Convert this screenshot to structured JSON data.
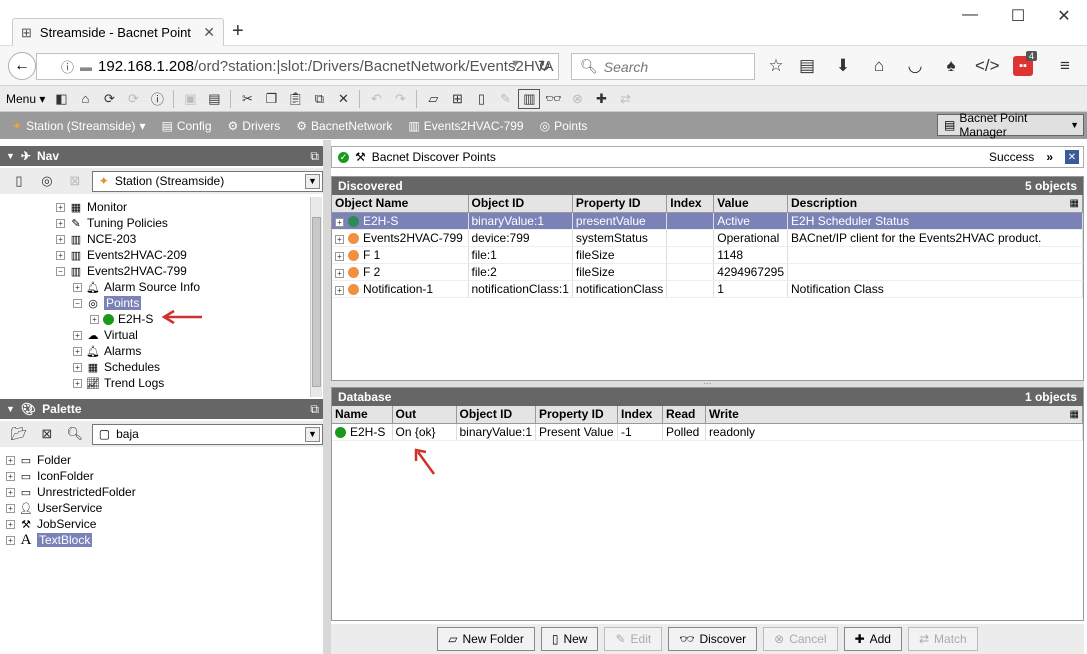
{
  "browser": {
    "tab_title": "Streamside - Bacnet Point ...",
    "url_host": "192.168.1.208",
    "url_path": "/ord?station:|slot:/Drivers/BacnetNetwork/Events2HVA",
    "search_placeholder": "Search",
    "ext_badge": "4"
  },
  "app_toolbar": {
    "menu_label": "Menu"
  },
  "locbar": {
    "items": [
      {
        "label": "Station (Streamside)",
        "icon": "fox-icon"
      },
      {
        "label": "Config",
        "icon": "config-icon"
      },
      {
        "label": "Drivers",
        "icon": "drivers-icon"
      },
      {
        "label": "BacnetNetwork",
        "icon": "network-icon"
      },
      {
        "label": "Events2HVAC-799",
        "icon": "device-icon"
      },
      {
        "label": "Points",
        "icon": "points-icon"
      }
    ],
    "view_label": "Bacnet Point Manager"
  },
  "nav": {
    "title": "Nav",
    "station": "Station (Streamside)",
    "tree": [
      {
        "label": "Monitor",
        "indent": 0,
        "pm": "+"
      },
      {
        "label": "Tuning Policies",
        "indent": 0,
        "pm": "+"
      },
      {
        "label": "NCE-203",
        "indent": 0,
        "pm": "+"
      },
      {
        "label": "Events2HVAC-209",
        "indent": 0,
        "pm": "+"
      },
      {
        "label": "Events2HVAC-799",
        "indent": 0,
        "pm": "-"
      },
      {
        "label": "Alarm Source Info",
        "indent": 1,
        "pm": "+"
      },
      {
        "label": "Points",
        "indent": 1,
        "pm": "-"
      },
      {
        "label": "E2H-S",
        "indent": 2,
        "pm": "+"
      },
      {
        "label": "Virtual",
        "indent": 1,
        "pm": "+"
      },
      {
        "label": "Alarms",
        "indent": 1,
        "pm": "+"
      },
      {
        "label": "Schedules",
        "indent": 1,
        "pm": "+"
      },
      {
        "label": "Trend Logs",
        "indent": 1,
        "pm": "+"
      }
    ]
  },
  "palette": {
    "title": "Palette",
    "module": "baja",
    "items": [
      "Folder",
      "IconFolder",
      "UnrestrictedFolder",
      "UserService",
      "JobService",
      "TextBlock"
    ]
  },
  "manager": {
    "job_title": "Bacnet Discover Points",
    "status": "Success",
    "discovered": {
      "title": "Discovered",
      "count": "5 objects",
      "columns": [
        "Object Name",
        "Object ID",
        "Property ID",
        "Index",
        "Value",
        "Description"
      ],
      "rows": [
        [
          "E2H-S",
          "binaryValue:1",
          "presentValue",
          "",
          "Active",
          "E2H Scheduler Status"
        ],
        [
          "Events2HVAC-799",
          "device:799",
          "systemStatus",
          "",
          "Operational",
          "BACnet/IP client for the Events2HVAC product."
        ],
        [
          "F 1",
          "file:1",
          "fileSize",
          "",
          "1148",
          ""
        ],
        [
          "F 2",
          "file:2",
          "fileSize",
          "",
          "4294967295",
          ""
        ],
        [
          "Notification-1",
          "notificationClass:1",
          "notificationClass",
          "",
          "1",
          "Notification Class"
        ]
      ]
    },
    "database": {
      "title": "Database",
      "count": "1 objects",
      "columns": [
        "Name",
        "Out",
        "Object ID",
        "Property ID",
        "Index",
        "Read",
        "Write"
      ],
      "rows": [
        [
          "E2H-S",
          "On {ok}",
          "binaryValue:1",
          "Present Value",
          "-1",
          "Polled",
          "readonly"
        ]
      ]
    },
    "buttons": [
      {
        "label": "New Folder",
        "enabled": true
      },
      {
        "label": "New",
        "enabled": true
      },
      {
        "label": "Edit",
        "enabled": false
      },
      {
        "label": "Discover",
        "enabled": true
      },
      {
        "label": "Cancel",
        "enabled": false
      },
      {
        "label": "Add",
        "enabled": true
      },
      {
        "label": "Match",
        "enabled": false
      }
    ]
  },
  "colors": {
    "selection": "#7a82b8",
    "header": "#666666",
    "arrow": "#d0312d"
  }
}
